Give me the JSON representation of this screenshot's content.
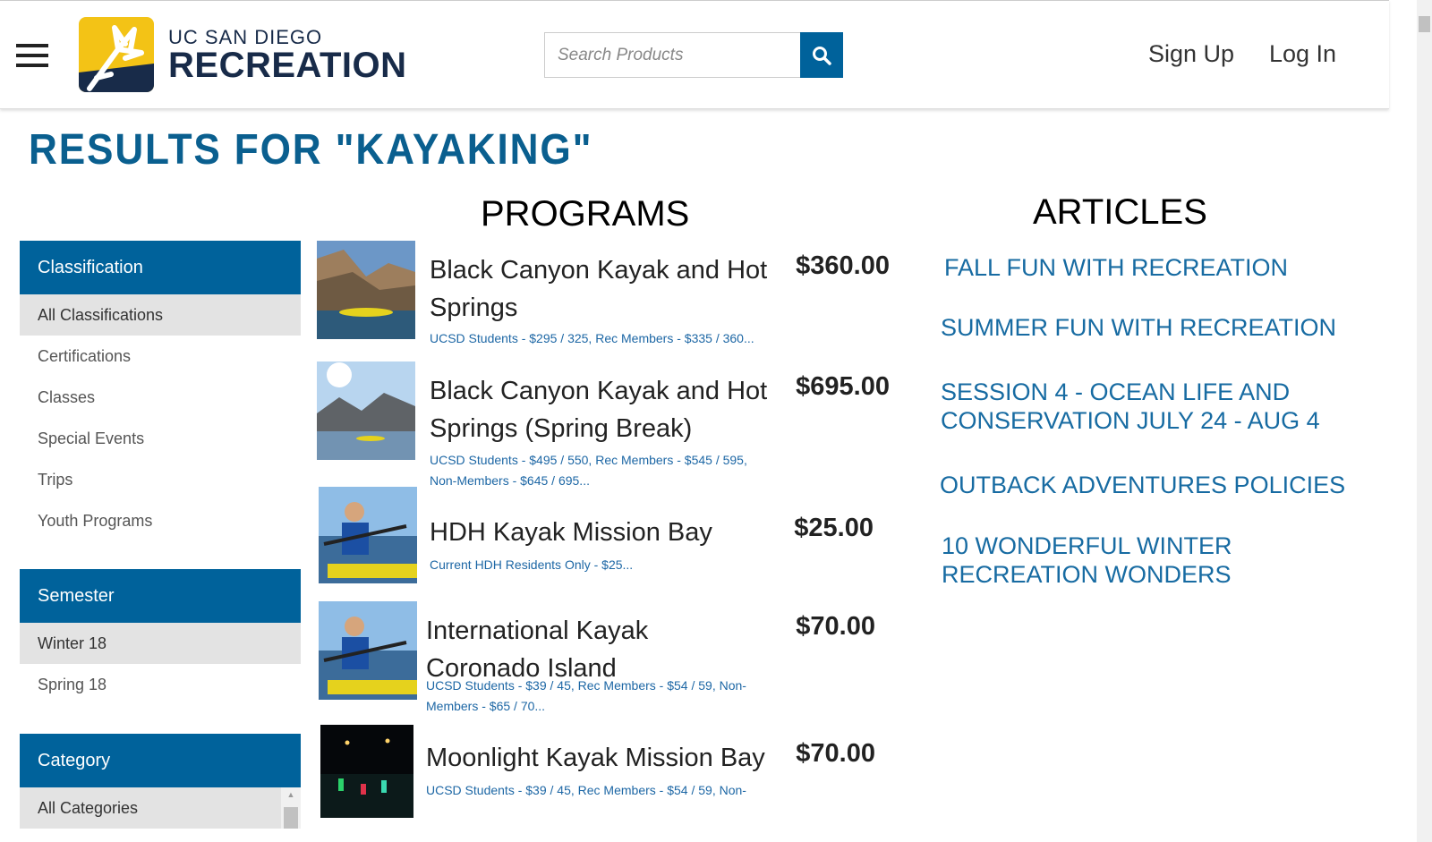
{
  "header": {
    "logo_line1": "UC SAN DIEGO",
    "logo_line2": "RECREATION",
    "search_placeholder": "Search Products",
    "signup_label": "Sign Up",
    "login_label": "Log In"
  },
  "page": {
    "title": "RESULTS FOR \"KAYAKING\""
  },
  "facets": {
    "classification": {
      "heading": "Classification",
      "items": [
        "All Classifications",
        "Certifications",
        "Classes",
        "Special Events",
        "Trips",
        "Youth Programs"
      ]
    },
    "semester": {
      "heading": "Semester",
      "items": [
        "Winter 18",
        "Spring 18"
      ]
    },
    "category": {
      "heading": "Category",
      "items": [
        "All Categories"
      ]
    }
  },
  "programs": {
    "heading": "PROGRAMS",
    "items": [
      {
        "name": "Black Canyon Kayak and Hot Springs",
        "price": "$360.00",
        "sub": "UCSD Students - $295 / 325, Rec Members - $335 / 360..."
      },
      {
        "name": "Black Canyon Kayak and Hot Springs (Spring Break)",
        "price": "$695.00",
        "sub": "UCSD Students - $495 / 550, Rec Members - $545 / 595, Non-Members - $645 / 695..."
      },
      {
        "name": "HDH Kayak Mission Bay",
        "price": "$25.00",
        "sub": "Current HDH Residents Only - $25..."
      },
      {
        "name": "International Kayak Coronado Island",
        "price": "$70.00",
        "sub": "UCSD Students - $39 / 45, Rec Members - $54 / 59, Non-Members - $65 / 70..."
      },
      {
        "name": "Moonlight Kayak Mission Bay",
        "price": "$70.00",
        "sub": "UCSD Students - $39 / 45, Rec Members - $54 / 59, Non-"
      }
    ]
  },
  "articles": {
    "heading": "ARTICLES",
    "items": [
      "FALL FUN WITH RECREATION",
      "SUMMER FUN WITH RECREATION",
      "SESSION 4 - OCEAN LIFE AND CONSERVATION JULY 24 - AUG 4",
      "OUTBACK ADVENTURES POLICIES",
      "10 WONDERFUL WINTER RECREATION WONDERS"
    ]
  },
  "colors": {
    "brand_blue": "#00629b",
    "navy": "#182b49",
    "gold": "#f3c316",
    "link_blue": "#176ba2"
  },
  "icons": {
    "menu": "hamburger-menu-icon",
    "search": "search-icon"
  }
}
